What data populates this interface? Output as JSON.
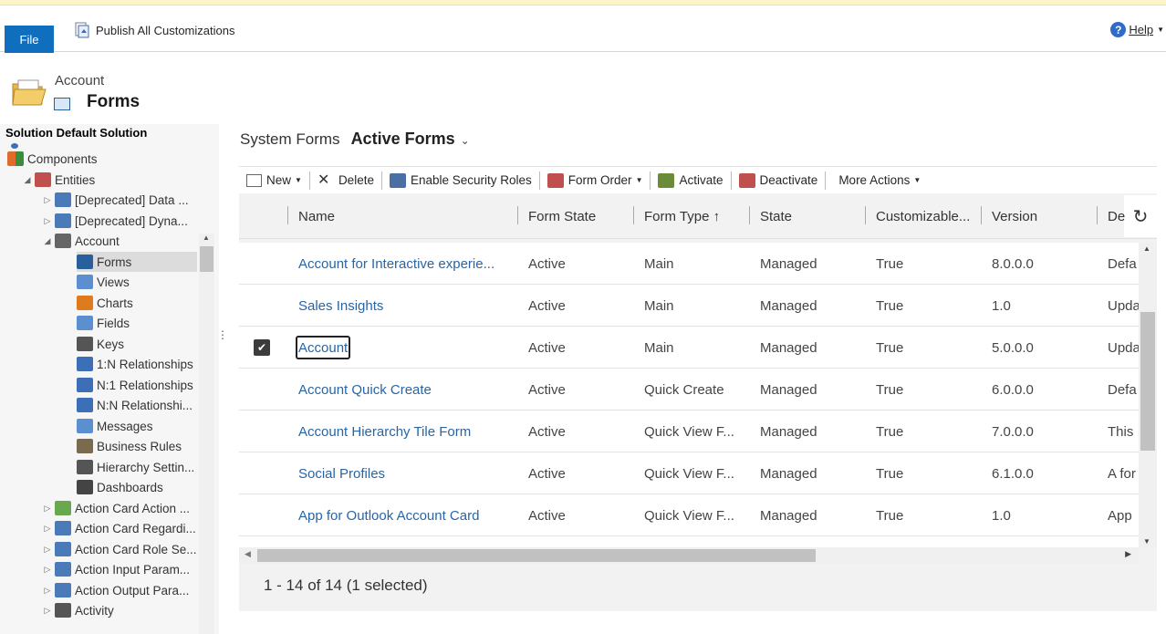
{
  "ribbon": {
    "file_label": "File",
    "publish_label": "Publish All Customizations",
    "help_label": "Help"
  },
  "entity": {
    "name": "Account",
    "section": "Forms",
    "solution_title": "Solution Default Solution"
  },
  "tree": [
    {
      "label": "",
      "indent": 0,
      "toggle": "",
      "icon": "dot-icon",
      "color": "#3b6fb6"
    },
    {
      "label": "Components",
      "indent": 0,
      "toggle": "",
      "icon": "components-icon",
      "color": "#e06c2c"
    },
    {
      "label": "Entities",
      "indent": 1,
      "toggle": "◢",
      "icon": "entities-icon",
      "color": "#c0504d"
    },
    {
      "label": "[Deprecated] Data ...",
      "indent": 2,
      "toggle": "▷",
      "icon": "entity-gear-icon",
      "color": "#4a7ab8"
    },
    {
      "label": "[Deprecated] Dyna...",
      "indent": 2,
      "toggle": "▷",
      "icon": "entity-gear-icon",
      "color": "#4a7ab8"
    },
    {
      "label": "Account",
      "indent": 2,
      "toggle": "◢",
      "icon": "account-icon",
      "color": "#666666"
    },
    {
      "label": "Forms",
      "indent": 3,
      "toggle": "",
      "icon": "forms-icon",
      "color": "#2a5f9e",
      "selected": true
    },
    {
      "label": "Views",
      "indent": 3,
      "toggle": "",
      "icon": "views-icon",
      "color": "#5b8fd0"
    },
    {
      "label": "Charts",
      "indent": 3,
      "toggle": "",
      "icon": "charts-icon",
      "color": "#e07a1f"
    },
    {
      "label": "Fields",
      "indent": 3,
      "toggle": "",
      "icon": "fields-icon",
      "color": "#5b8fd0"
    },
    {
      "label": "Keys",
      "indent": 3,
      "toggle": "",
      "icon": "keys-icon",
      "color": "#555555"
    },
    {
      "label": "1:N Relationships",
      "indent": 3,
      "toggle": "",
      "icon": "relationship-icon",
      "color": "#3d6fb8"
    },
    {
      "label": "N:1 Relationships",
      "indent": 3,
      "toggle": "",
      "icon": "relationship-icon",
      "color": "#3d6fb8"
    },
    {
      "label": "N:N Relationshi...",
      "indent": 3,
      "toggle": "",
      "icon": "relationship-icon",
      "color": "#3d6fb8"
    },
    {
      "label": "Messages",
      "indent": 3,
      "toggle": "",
      "icon": "messages-icon",
      "color": "#5b8fd0"
    },
    {
      "label": "Business Rules",
      "indent": 3,
      "toggle": "",
      "icon": "business-rules-icon",
      "color": "#7a6b4f"
    },
    {
      "label": "Hierarchy Settin...",
      "indent": 3,
      "toggle": "",
      "icon": "hierarchy-icon",
      "color": "#555555"
    },
    {
      "label": "Dashboards",
      "indent": 3,
      "toggle": "",
      "icon": "dashboards-icon",
      "color": "#444444"
    },
    {
      "label": "Action Card Action ...",
      "indent": 2,
      "toggle": "▷",
      "icon": "image-icon",
      "color": "#6aa84f"
    },
    {
      "label": "Action Card Regardi...",
      "indent": 2,
      "toggle": "▷",
      "icon": "entity-gear-icon",
      "color": "#4a7ab8"
    },
    {
      "label": "Action Card Role Se...",
      "indent": 2,
      "toggle": "▷",
      "icon": "entity-gear-icon",
      "color": "#4a7ab8"
    },
    {
      "label": "Action Input Param...",
      "indent": 2,
      "toggle": "▷",
      "icon": "entity-gear-icon",
      "color": "#4a7ab8"
    },
    {
      "label": "Action Output Para...",
      "indent": 2,
      "toggle": "▷",
      "icon": "entity-gear-icon",
      "color": "#4a7ab8"
    },
    {
      "label": "Activity",
      "indent": 2,
      "toggle": "▷",
      "icon": "activity-icon",
      "color": "#555555"
    }
  ],
  "main": {
    "system_forms_label": "System Forms",
    "view_label": "Active Forms"
  },
  "commands": [
    {
      "label": "New",
      "icon": "new-form-icon",
      "dropdown": true
    },
    {
      "label": "Delete",
      "icon": "delete-icon",
      "dropdown": false
    },
    {
      "label": "Enable Security Roles",
      "icon": "security-roles-icon",
      "dropdown": false
    },
    {
      "label": "Form Order",
      "icon": "form-order-icon",
      "dropdown": true
    },
    {
      "label": "Activate",
      "icon": "activate-icon",
      "dropdown": false
    },
    {
      "label": "Deactivate",
      "icon": "deactivate-icon",
      "dropdown": false
    },
    {
      "label": "More Actions",
      "icon": "",
      "dropdown": true
    }
  ],
  "grid": {
    "columns": [
      "Name",
      "Form State",
      "Form Type ↑",
      "State",
      "Customizable...",
      "Version",
      "De"
    ],
    "rows": [
      {
        "selected": false,
        "cells": [
          "Account for Interactive experie...",
          "Active",
          "Main",
          "Managed",
          "True",
          "8.0.0.0",
          "Defa"
        ]
      },
      {
        "selected": false,
        "cells": [
          "Sales Insights",
          "Active",
          "Main",
          "Managed",
          "True",
          "1.0",
          "Upda"
        ]
      },
      {
        "selected": true,
        "cells": [
          "Account",
          "Active",
          "Main",
          "Managed",
          "True",
          "5.0.0.0",
          "Upda"
        ]
      },
      {
        "selected": false,
        "cells": [
          "Account Quick Create",
          "Active",
          "Quick Create",
          "Managed",
          "True",
          "6.0.0.0",
          "Defa"
        ]
      },
      {
        "selected": false,
        "cells": [
          "Account Hierarchy Tile Form",
          "Active",
          "Quick View F...",
          "Managed",
          "True",
          "7.0.0.0",
          "This"
        ]
      },
      {
        "selected": false,
        "cells": [
          "Social Profiles",
          "Active",
          "Quick View F...",
          "Managed",
          "True",
          "6.1.0.0",
          "A for"
        ]
      },
      {
        "selected": false,
        "cells": [
          "App for Outlook Account Card",
          "Active",
          "Quick View F...",
          "Managed",
          "True",
          "1.0",
          "App"
        ]
      }
    ],
    "footer": "1 - 14 of 14 (1 selected)"
  },
  "colors": {
    "accent": "#106ebe",
    "link": "#2865a6"
  }
}
